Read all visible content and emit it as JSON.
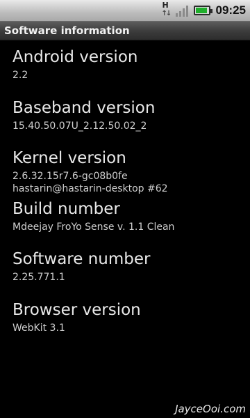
{
  "status_bar": {
    "network_type": "H",
    "time": "09:25",
    "battery_level": 0.9,
    "signal_bars": 0
  },
  "title_bar": {
    "title": "Software information"
  },
  "items": [
    {
      "label": "Android version",
      "values": [
        "2.2"
      ]
    },
    {
      "label": "Baseband version",
      "values": [
        "15.40.50.07U_2.12.50.02_2"
      ]
    },
    {
      "label": "Kernel version",
      "values": [
        "2.6.32.15r7.6-gc08b0fe",
        "hastarin@hastarin-desktop #62"
      ]
    },
    {
      "label": "Build number",
      "values": [
        "Mdeejay FroYo Sense v. 1.1 Clean"
      ]
    },
    {
      "label": "Software number",
      "values": [
        "2.25.771.1"
      ]
    },
    {
      "label": "Browser version",
      "values": [
        "WebKit 3.1"
      ]
    }
  ],
  "watermark": "JayceOoi.com"
}
